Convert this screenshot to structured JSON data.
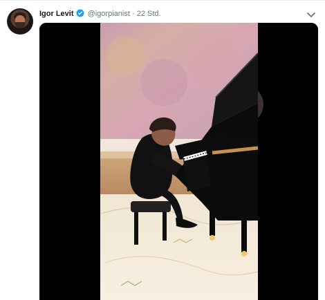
{
  "tweet": {
    "display_name": "Igor Levit",
    "handle": "@igorpianist",
    "separator": "·",
    "time": "22 Std.",
    "icons": {
      "avatar": "profile-photo",
      "verified": "verified-badge-icon",
      "menu": "chevron-down-icon"
    },
    "colors": {
      "name": "#14171a",
      "meta": "#657786",
      "verified": "#1da1f2",
      "video_background": "#000000"
    }
  },
  "media": {
    "type": "video",
    "subject": "pianist at grand piano"
  }
}
